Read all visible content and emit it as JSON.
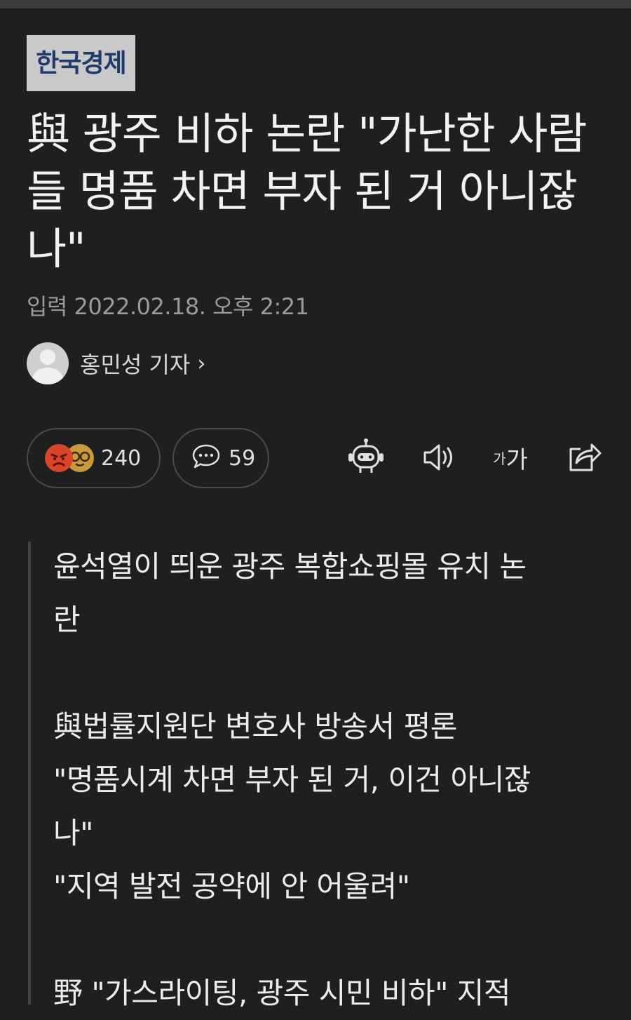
{
  "source": {
    "logo_text": "한국경제"
  },
  "article": {
    "headline": "與 광주 비하 논란 \"가난한 사람들 명품 차면 부자 된 거 아니잖나\"",
    "date": "입력 2022.02.18. 오후 2:21",
    "author": "홍민성 기자",
    "author_chevron": "›"
  },
  "actions": {
    "reaction_count": "240",
    "comment_count": "59",
    "font_size_label_small": "가",
    "font_size_label_large": "가"
  },
  "icons": {
    "reactions": [
      "angry-face",
      "nerd-face"
    ],
    "comment": "speech-bubble-icon",
    "toolbar": [
      "robot-summary-icon",
      "speaker-icon",
      "font-size-icon",
      "share-icon"
    ]
  },
  "summary": {
    "lines": [
      "윤석열이 띄운 광주 복합쇼핑몰 유치 논",
      "란",
      "",
      "與법률지원단 변호사 방송서 평론",
      "\"명품시계 차면 부자 된 거, 이건 아니잖",
      "나\"",
      "\"지역 발전 공약에 안 어울려\"",
      "",
      "野 \"가스라이팅, 광주 시민 비하\" 지적"
    ]
  }
}
